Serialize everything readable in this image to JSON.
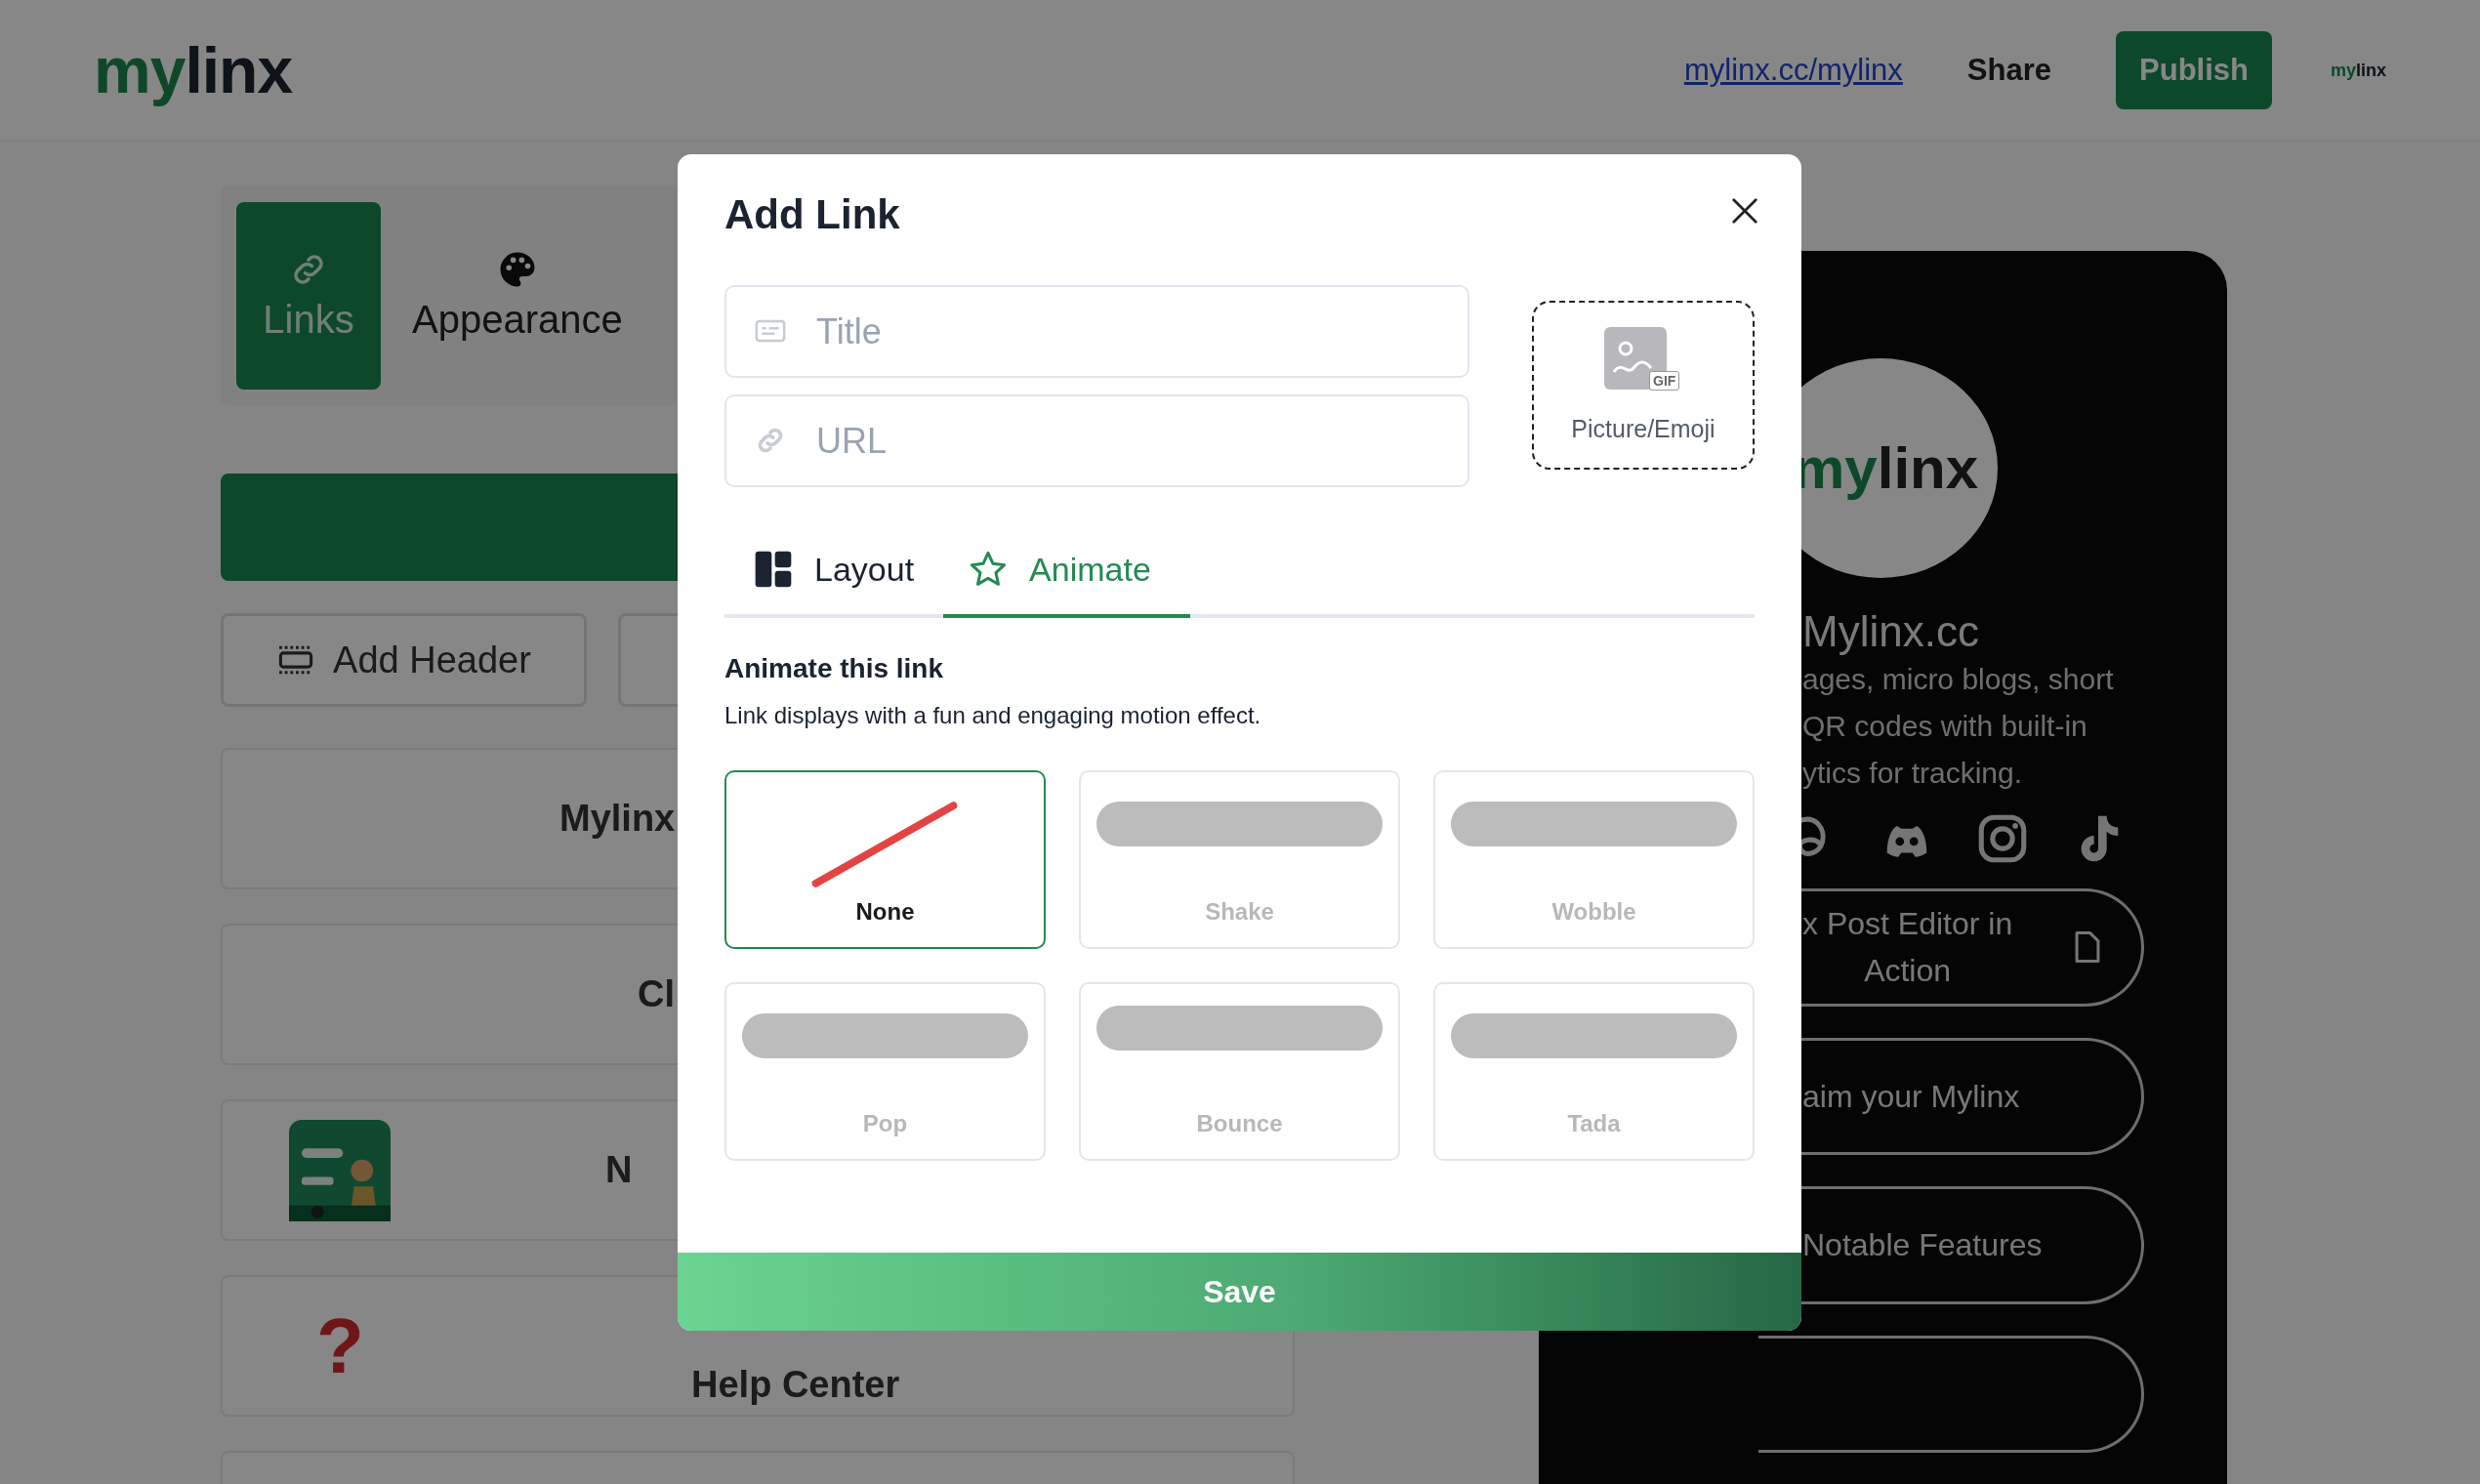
{
  "header": {
    "logo": {
      "accent": "my",
      "rest": "linx"
    },
    "profile_link": "mylinx.cc/mylinx",
    "share": "Share",
    "publish": "Publish",
    "mini_logo": {
      "accent": "my",
      "rest": "linx"
    }
  },
  "editor": {
    "tabs": [
      {
        "label": "Links",
        "selected": true
      },
      {
        "label": "Appearance",
        "selected": false
      }
    ],
    "add_header": "Add Header",
    "link_cards": [
      {
        "kind": "text",
        "title": "Mylinx"
      },
      {
        "kind": "text",
        "title": "Cl"
      },
      {
        "kind": "thumb",
        "title": "N"
      },
      {
        "kind": "glyph",
        "glyph": "?",
        "title": "Help Center"
      },
      {
        "kind": "empty"
      }
    ]
  },
  "modal": {
    "title": "Add Link",
    "fields": [
      {
        "kind": "title",
        "placeholder": "Title"
      },
      {
        "kind": "url",
        "placeholder": "URL"
      }
    ],
    "media_button": {
      "label": "Picture/Emoji",
      "badge": "GIF"
    },
    "tabs": [
      {
        "label": "Layout",
        "kind": "layout",
        "selected": false
      },
      {
        "label": "Animate",
        "kind": "animate",
        "selected": true
      }
    ],
    "section_title": "Animate this link",
    "section_text": "Link displays with a fun and engaging motion effect.",
    "options": [
      {
        "label": "None",
        "kind": "none",
        "selected": true
      },
      {
        "label": "Shake",
        "kind": "mid",
        "selected": false
      },
      {
        "label": "Wobble",
        "kind": "mid",
        "selected": false
      },
      {
        "label": "Pop",
        "kind": "low",
        "selected": false
      },
      {
        "label": "Bounce",
        "kind": "high",
        "selected": false
      },
      {
        "label": "Tada",
        "kind": "low",
        "selected": false
      }
    ],
    "save": "Save"
  },
  "preview": {
    "avatar_logo": {
      "accent": "my",
      "rest": "linx"
    },
    "name": "Mylinx.cc",
    "bio_lines": [
      "ages, micro blogs, short",
      "QR codes with built-in",
      "ytics for tracking."
    ],
    "links": [
      {
        "lines": [
          "x Post Editor in",
          "Action"
        ],
        "file_icon": true
      },
      {
        "lines": [
          "aim your Mylinx"
        ],
        "file_icon": false
      },
      {
        "lines": [
          "Notable Features"
        ],
        "file_icon": false
      },
      {
        "file_icon": false
      }
    ]
  }
}
